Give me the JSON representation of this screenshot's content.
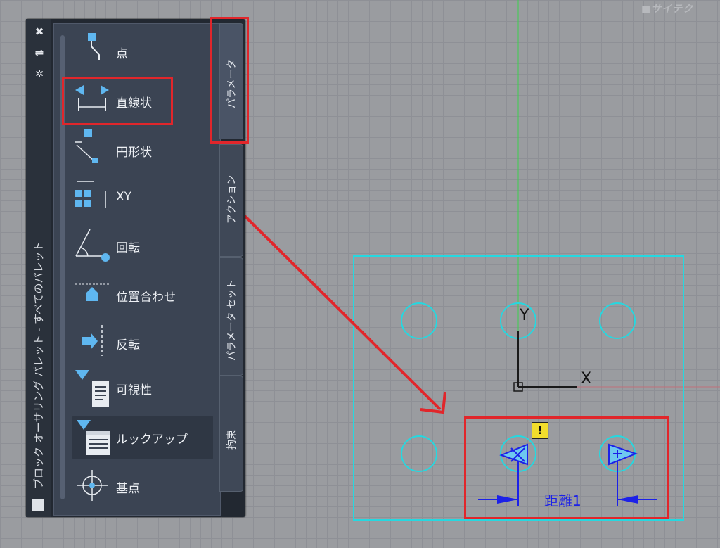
{
  "watermark": "■サイテク",
  "palette": {
    "title": "ブロック オーサリング パレット - すべてのパレット",
    "window_buttons": {
      "close": "✖",
      "autohide": "⇌",
      "properties": "✲"
    },
    "tools": [
      {
        "label": "点",
        "icon": "point-parameter-icon"
      },
      {
        "label": "直線状",
        "icon": "linear-parameter-icon"
      },
      {
        "label": "円形状",
        "icon": "polar-parameter-icon"
      },
      {
        "label": "XY",
        "icon": "xy-parameter-icon"
      },
      {
        "label": "回転",
        "icon": "rotation-parameter-icon"
      },
      {
        "label": "位置合わせ",
        "icon": "alignment-parameter-icon"
      },
      {
        "label": "反転",
        "icon": "flip-parameter-icon"
      },
      {
        "label": "可視性",
        "icon": "visibility-parameter-icon"
      },
      {
        "label": "ルックアップ",
        "icon": "lookup-parameter-icon"
      },
      {
        "label": "基点",
        "icon": "base-point-parameter-icon"
      }
    ],
    "tabs": [
      {
        "label": "パラメータ",
        "active": true
      },
      {
        "label": "アクション",
        "active": false
      },
      {
        "label": "パラメータ セット",
        "active": false
      },
      {
        "label": "拘束",
        "active": false
      }
    ]
  },
  "drawing": {
    "axis_x": "X",
    "axis_y": "Y",
    "dimension_label": "距離1",
    "warning_badge": "!"
  },
  "colors": {
    "annotation_red": "#e1262b",
    "cyan_geometry": "#25d8e0",
    "dimension_blue": "#1c21e8",
    "warning_yellow": "#f2dd2c"
  }
}
